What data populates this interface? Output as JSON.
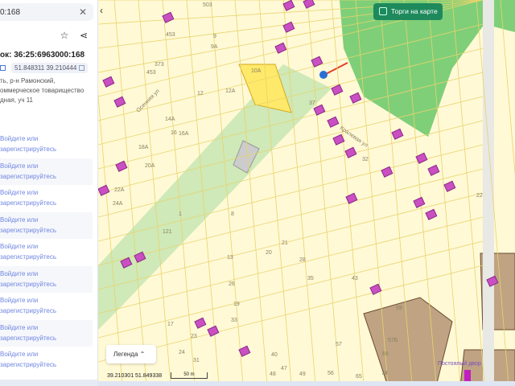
{
  "panel": {
    "search_value": "0:168",
    "close_icon": "close-icon",
    "title": "ок: 36:25:6963000:168",
    "coordinates": "51.848311 39.210444",
    "address_lines": [
      "ть, р-н Рамонский,",
      "оммерческое товарищество",
      "дная, уч 11"
    ],
    "login_prompts": [
      "Войдите или зарегистрируйтесь",
      "Войдите или зарегистрируйтесь",
      "Войдите или зарегистрируйтесь",
      "Войдите или зарегистрируйтесь",
      "Войдите или зарегистрируйтесь",
      "Войдите или зарегистрируйтесь",
      "Войдите или зарегистрируйтесь",
      "Войдите или зарегистрируйтесь",
      "Войдите или зарегистрируйтесь"
    ]
  },
  "map": {
    "torgi_label": "Торги на карте",
    "legend_label": "Легенда",
    "cursor_coords": "39.210301  51.849338",
    "scale_label": "50 m",
    "place_label": "Постоялый двор",
    "streets": [
      "Осенняя ул",
      "Кралевая ул"
    ],
    "parcels": [
      "503",
      "9",
      "9А",
      "453",
      "373",
      "453",
      "10А",
      "12А",
      "12",
      "14А",
      "16А",
      "16",
      "18А",
      "20А",
      "22А",
      "24А",
      "8",
      "1",
      "121",
      "21",
      "20",
      "13",
      "28",
      "26",
      "35",
      "43",
      "19",
      "33",
      "59",
      "17",
      "23",
      "24",
      "31",
      "40",
      "49",
      "57",
      "48",
      "47",
      "56",
      "65",
      "66",
      "74",
      "57Б",
      "37",
      "32",
      "22"
    ]
  },
  "colors": {
    "accent": "#1e8a5c",
    "forest": "#7fcf79",
    "parcel": "#fff2a8",
    "building": "#c94fc2"
  }
}
